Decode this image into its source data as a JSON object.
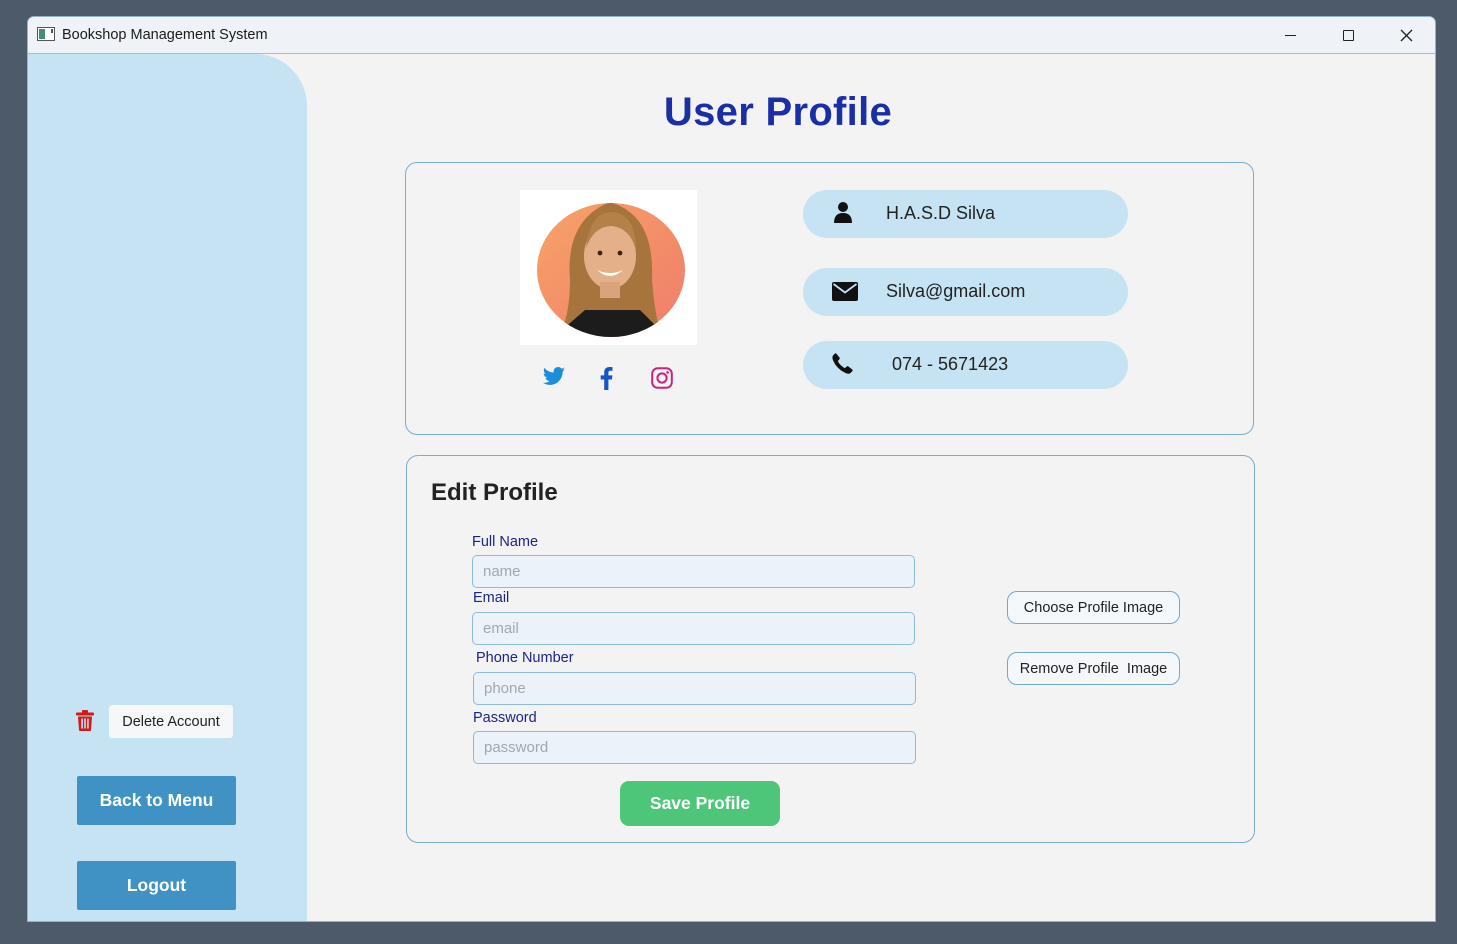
{
  "window": {
    "title": "Bookshop Management System"
  },
  "sidebar": {
    "delete_account_label": "Delete Account",
    "back_to_menu_label": "Back to Menu",
    "logout_label": "Logout"
  },
  "page": {
    "title": "User Profile"
  },
  "profile": {
    "name": "H.A.S.D Silva",
    "email": "Silva@gmail.com",
    "phone": "074 - 5671423",
    "social_icons": [
      "twitter-icon",
      "facebook-icon",
      "instagram-icon"
    ]
  },
  "edit_profile": {
    "heading": "Edit Profile",
    "full_name_label": "Full Name",
    "full_name_placeholder": "name",
    "email_label": "Email",
    "email_placeholder": "email",
    "phone_label": "Phone Number",
    "phone_placeholder": "phone",
    "password_label": "Password",
    "password_placeholder": "password",
    "save_label": "Save Profile",
    "choose_image_label": "Choose Profile Image",
    "remove_image_label": "Remove Profile  Image"
  },
  "colors": {
    "sidebar_bg": "#c5e3f3",
    "title": "#1a2ea6",
    "primary_button": "#3f92c3",
    "save_button": "#4ec67a",
    "delete_icon": "#d11a1a"
  }
}
